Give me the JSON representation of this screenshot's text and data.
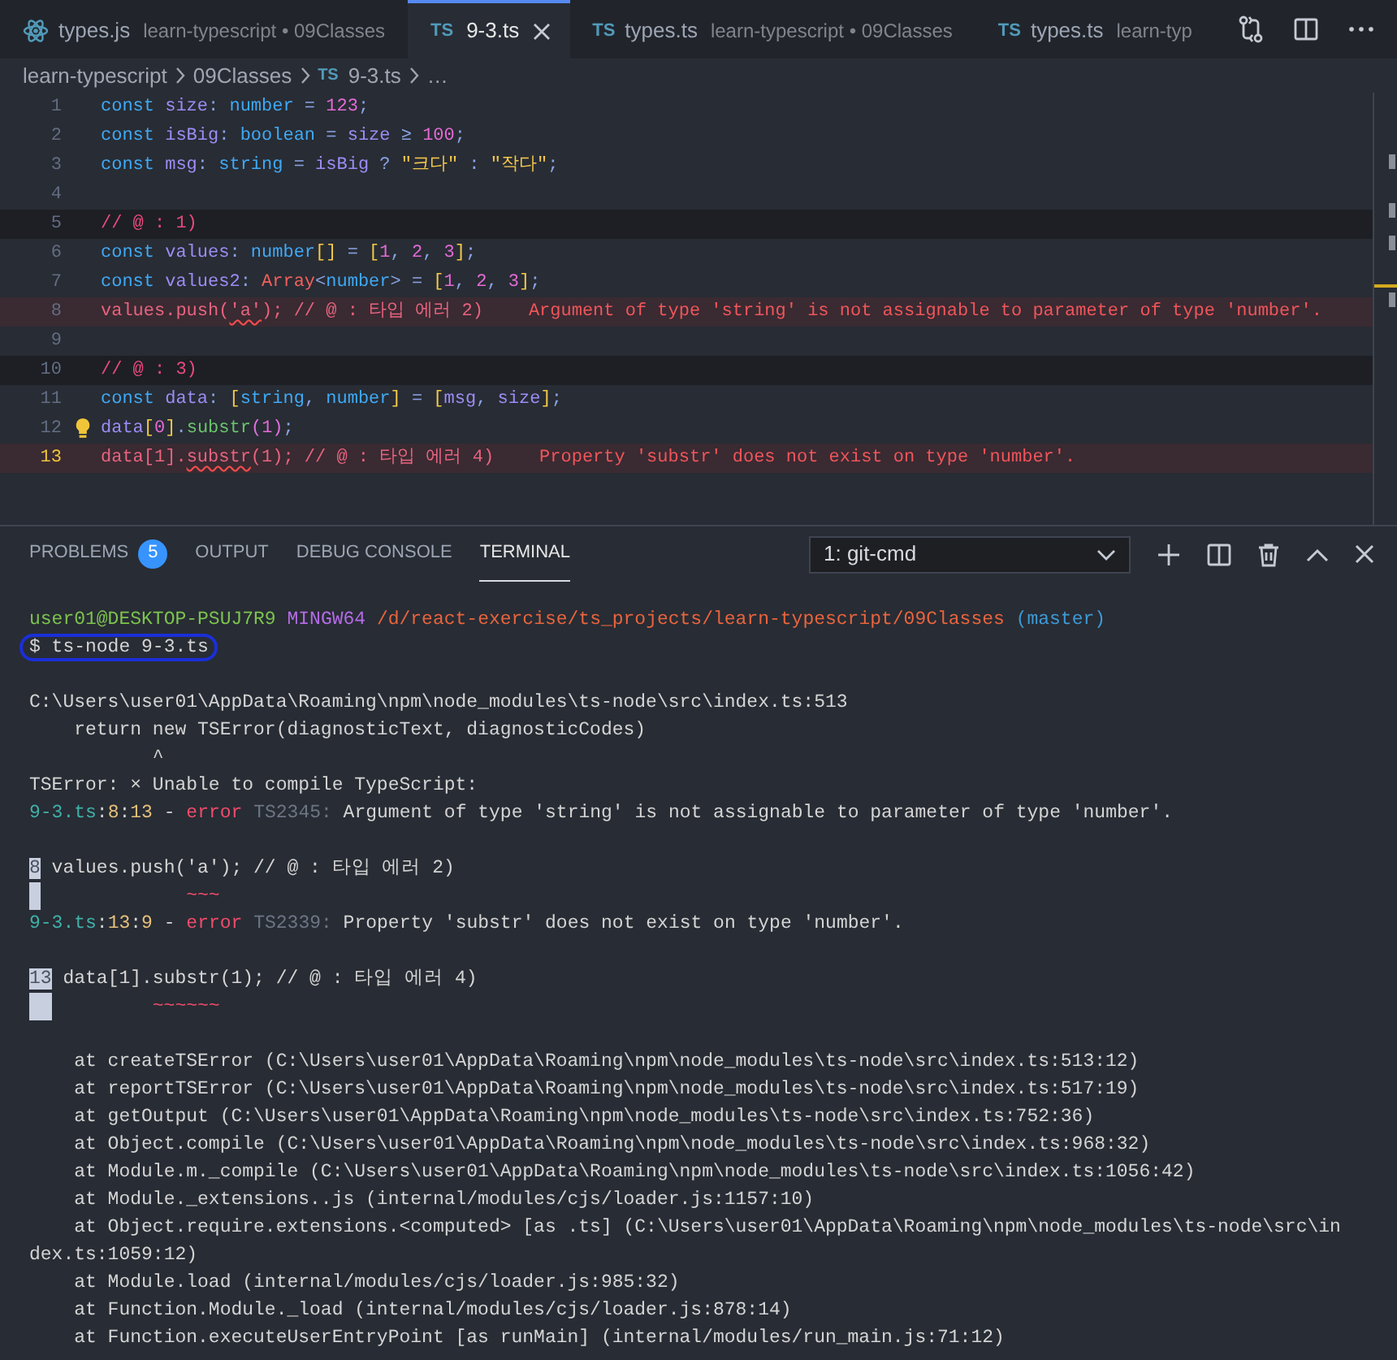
{
  "editor_tabs": [
    {
      "kind": "js",
      "name": "types.js",
      "description": "learn-typescript • 09Classes",
      "selected": false
    },
    {
      "kind": "ts",
      "badge": "TS",
      "name": "9-3.ts",
      "selected": true
    },
    {
      "kind": "ts",
      "badge": "TS",
      "name": "types.ts",
      "description": "learn-typescript • 09Classes",
      "selected": false
    },
    {
      "kind": "ts",
      "badge": "TS",
      "name": "types.ts",
      "description": "learn-typ",
      "selected": false
    }
  ],
  "breadcrumb": [
    {
      "text": "learn-typescript"
    },
    {
      "text": "09Classes"
    },
    {
      "badge": "TS",
      "text": "9-3.ts"
    },
    {
      "text": "…"
    }
  ],
  "code_lines": [
    {
      "number": "1",
      "error": false,
      "banded": false,
      "current": false,
      "lightbulb": false,
      "tokens": [
        {
          "kind": "kw",
          "text": "const "
        },
        {
          "kind": "var",
          "text": "size"
        },
        {
          "kind": "op",
          "text": ": "
        },
        {
          "kind": "type",
          "text": "number"
        },
        {
          "kind": "op",
          "text": " = "
        },
        {
          "kind": "num",
          "text": "123"
        },
        {
          "kind": "op",
          "text": ";"
        }
      ]
    },
    {
      "number": "2",
      "error": false,
      "banded": false,
      "current": false,
      "lightbulb": false,
      "tokens": [
        {
          "kind": "kw",
          "text": "const "
        },
        {
          "kind": "var",
          "text": "isBig"
        },
        {
          "kind": "op",
          "text": ": "
        },
        {
          "kind": "type",
          "text": "boolean"
        },
        {
          "kind": "op",
          "text": " = "
        },
        {
          "kind": "var",
          "text": "size"
        },
        {
          "kind": "op",
          "text": " ≥ "
        },
        {
          "kind": "num",
          "text": "100"
        },
        {
          "kind": "op",
          "text": ";"
        }
      ]
    },
    {
      "number": "3",
      "error": false,
      "banded": false,
      "current": false,
      "lightbulb": false,
      "tokens": [
        {
          "kind": "kw",
          "text": "const "
        },
        {
          "kind": "var",
          "text": "msg"
        },
        {
          "kind": "op",
          "text": ": "
        },
        {
          "kind": "type",
          "text": "string"
        },
        {
          "kind": "op",
          "text": " = "
        },
        {
          "kind": "var",
          "text": "isBig"
        },
        {
          "kind": "op",
          "text": " ? "
        },
        {
          "kind": "str",
          "text": "\"크다\""
        },
        {
          "kind": "op",
          "text": " : "
        },
        {
          "kind": "str",
          "text": "\"작다\""
        },
        {
          "kind": "op",
          "text": ";"
        }
      ]
    },
    {
      "number": "4",
      "error": false,
      "banded": false,
      "current": false,
      "lightbulb": false
    },
    {
      "number": "5",
      "error": false,
      "banded": true,
      "current": false,
      "lightbulb": false,
      "tokens": [
        {
          "kind": "cm",
          "text": "// @ : 1)"
        }
      ]
    },
    {
      "number": "6",
      "error": false,
      "banded": false,
      "current": false,
      "lightbulb": false,
      "tokens": [
        {
          "kind": "kw",
          "text": "const "
        },
        {
          "kind": "var",
          "text": "values"
        },
        {
          "kind": "op",
          "text": ": "
        },
        {
          "kind": "type",
          "text": "number"
        },
        {
          "kind": "b1",
          "text": "[]"
        },
        {
          "kind": "op",
          "text": " = "
        },
        {
          "kind": "b1",
          "text": "["
        },
        {
          "kind": "num",
          "text": "1"
        },
        {
          "kind": "op",
          "text": ", "
        },
        {
          "kind": "num",
          "text": "2"
        },
        {
          "kind": "op",
          "text": ", "
        },
        {
          "kind": "num",
          "text": "3"
        },
        {
          "kind": "b1",
          "text": "]"
        },
        {
          "kind": "op",
          "text": ";"
        }
      ]
    },
    {
      "number": "7",
      "error": false,
      "banded": false,
      "current": false,
      "lightbulb": false,
      "tokens": [
        {
          "kind": "kw",
          "text": "const "
        },
        {
          "kind": "var",
          "text": "values2"
        },
        {
          "kind": "op",
          "text": ": "
        },
        {
          "kind": "cls",
          "text": "Array"
        },
        {
          "kind": "op",
          "text": "<"
        },
        {
          "kind": "type",
          "text": "number"
        },
        {
          "kind": "op",
          "text": "> = "
        },
        {
          "kind": "b1",
          "text": "["
        },
        {
          "kind": "num",
          "text": "1"
        },
        {
          "kind": "op",
          "text": ", "
        },
        {
          "kind": "num",
          "text": "2"
        },
        {
          "kind": "op",
          "text": ", "
        },
        {
          "kind": "num",
          "text": "3"
        },
        {
          "kind": "b1",
          "text": "]"
        },
        {
          "kind": "op",
          "text": ";"
        }
      ]
    },
    {
      "number": "8",
      "error": true,
      "banded": false,
      "current": false,
      "lightbulb": false,
      "tokens": [
        {
          "kind": "err",
          "text": "values.push("
        },
        {
          "kind": "err",
          "text": "'a'",
          "squiggle": true
        },
        {
          "kind": "err",
          "text": "); // @ : 타입 에러 2)"
        }
      ],
      "diagnostic": "Argument of type 'string' is not assignable to parameter of type 'number'."
    },
    {
      "number": "9",
      "error": false,
      "banded": false,
      "current": false,
      "lightbulb": false
    },
    {
      "number": "10",
      "error": false,
      "banded": true,
      "current": false,
      "lightbulb": false,
      "tokens": [
        {
          "kind": "cm",
          "text": "// @ : 3)"
        }
      ]
    },
    {
      "number": "11",
      "error": false,
      "banded": false,
      "current": false,
      "lightbulb": false,
      "tokens": [
        {
          "kind": "kw",
          "text": "const "
        },
        {
          "kind": "var",
          "text": "data"
        },
        {
          "kind": "op",
          "text": ": "
        },
        {
          "kind": "b1",
          "text": "["
        },
        {
          "kind": "type",
          "text": "string"
        },
        {
          "kind": "op",
          "text": ", "
        },
        {
          "kind": "type",
          "text": "number"
        },
        {
          "kind": "b1",
          "text": "]"
        },
        {
          "kind": "op",
          "text": " = "
        },
        {
          "kind": "b1",
          "text": "["
        },
        {
          "kind": "var",
          "text": "msg"
        },
        {
          "kind": "op",
          "text": ", "
        },
        {
          "kind": "var",
          "text": "size"
        },
        {
          "kind": "b1",
          "text": "]"
        },
        {
          "kind": "op",
          "text": ";"
        }
      ]
    },
    {
      "number": "12",
      "error": false,
      "banded": false,
      "current": false,
      "lightbulb": true,
      "tokens": [
        {
          "kind": "var",
          "text": "data"
        },
        {
          "kind": "b1",
          "text": "["
        },
        {
          "kind": "num",
          "text": "0"
        },
        {
          "kind": "b1",
          "text": "]"
        },
        {
          "kind": "op",
          "text": "."
        },
        {
          "kind": "fn",
          "text": "substr"
        },
        {
          "kind": "b2",
          "text": "("
        },
        {
          "kind": "num",
          "text": "1"
        },
        {
          "kind": "b2",
          "text": ")"
        },
        {
          "kind": "op",
          "text": ";"
        }
      ]
    },
    {
      "number": "13",
      "error": true,
      "banded": false,
      "current": true,
      "lightbulb": false,
      "tokens": [
        {
          "kind": "err",
          "text": "data[1]."
        },
        {
          "kind": "err",
          "text": "substr",
          "squiggle": true
        },
        {
          "kind": "err",
          "text": "(1); // @ : 타입 에러 4)"
        }
      ],
      "diagnostic": "Property 'substr' does not exist on type 'number'."
    }
  ],
  "panel_tabs": [
    {
      "label": "PROBLEMS",
      "badge": "5",
      "selected": false
    },
    {
      "label": "OUTPUT",
      "selected": false
    },
    {
      "label": "DEBUG CONSOLE",
      "selected": false
    },
    {
      "label": "TERMINAL",
      "selected": true
    }
  ],
  "terminal_select": {
    "value": "1: git-cmd"
  },
  "terminal_lines": [
    {
      "kind": "text",
      "segments": [
        {
          "kind": "user",
          "text": "user01@DESKTOP-PSUJ7R9 "
        },
        {
          "kind": "host",
          "text": "MINGW64 "
        },
        {
          "kind": "path",
          "text": "/d/react-exercise/ts_projects/learn-typescript/09Classes "
        },
        {
          "kind": "branch",
          "text": "(master)"
        }
      ]
    },
    {
      "kind": "text",
      "segments": [
        {
          "kind": "cmd",
          "text": "$ ts-node 9-3.ts"
        }
      ]
    },
    {
      "kind": "blank"
    },
    {
      "kind": "text",
      "segments": [
        {
          "kind": "plain",
          "text": "C:\\Users\\user01\\AppData\\Roaming\\npm\\node_modules\\ts-node\\src\\index.ts:513"
        }
      ]
    },
    {
      "kind": "text",
      "segments": [
        {
          "kind": "plain",
          "text": "    return new TSError(diagnosticText, diagnosticCodes)"
        }
      ]
    },
    {
      "kind": "text",
      "segments": [
        {
          "kind": "plain",
          "text": "           ^"
        }
      ]
    },
    {
      "kind": "text",
      "segments": [
        {
          "kind": "plain",
          "text": "TSError: × Unable to compile TypeScript:"
        }
      ]
    },
    {
      "kind": "text",
      "segments": [
        {
          "kind": "file",
          "text": "9-3.ts"
        },
        {
          "kind": "plain",
          "text": ":"
        },
        {
          "kind": "pos",
          "text": "8"
        },
        {
          "kind": "plain",
          "text": ":"
        },
        {
          "kind": "pos",
          "text": "13"
        },
        {
          "kind": "plain",
          "text": " - "
        },
        {
          "kind": "error",
          "text": "error "
        },
        {
          "kind": "code",
          "text": "TS2345:"
        },
        {
          "kind": "plain",
          "text": " Argument of type 'string' is not assignable to parameter of type 'number'."
        }
      ]
    },
    {
      "kind": "blank"
    },
    {
      "kind": "text",
      "segments": [
        {
          "kind": "gutter",
          "text": "8"
        },
        {
          "kind": "plain",
          "text": " values.push('a'); // @ : 타입 에러 2)"
        }
      ]
    },
    {
      "kind": "text",
      "segments": [
        {
          "kind": "gutter"
        },
        {
          "kind": "squiggle",
          "text": "             ~~~"
        }
      ]
    },
    {
      "kind": "text",
      "segments": [
        {
          "kind": "file",
          "text": "9-3.ts"
        },
        {
          "kind": "plain",
          "text": ":"
        },
        {
          "kind": "pos",
          "text": "13"
        },
        {
          "kind": "plain",
          "text": ":"
        },
        {
          "kind": "pos",
          "text": "9"
        },
        {
          "kind": "plain",
          "text": " - "
        },
        {
          "kind": "error",
          "text": "error "
        },
        {
          "kind": "code",
          "text": "TS2339:"
        },
        {
          "kind": "plain",
          "text": " Property 'substr' does not exist on type 'number'."
        }
      ]
    },
    {
      "kind": "blank"
    },
    {
      "kind": "text",
      "segments": [
        {
          "kind": "gutter",
          "text": "13"
        },
        {
          "kind": "plain",
          "text": " data[1].substr(1); // @ : 타입 에러 4)"
        }
      ]
    },
    {
      "kind": "text",
      "segments": [
        {
          "kind": "gutter"
        },
        {
          "kind": "gutter"
        },
        {
          "kind": "squiggle",
          "text": "         ~~~~~~"
        }
      ]
    },
    {
      "kind": "blank"
    },
    {
      "kind": "text",
      "segments": [
        {
          "kind": "plain",
          "text": "    at createTSError (C:\\Users\\user01\\AppData\\Roaming\\npm\\node_modules\\ts-node\\src\\index.ts:513:12)"
        }
      ]
    },
    {
      "kind": "text",
      "segments": [
        {
          "kind": "plain",
          "text": "    at reportTSError (C:\\Users\\user01\\AppData\\Roaming\\npm\\node_modules\\ts-node\\src\\index.ts:517:19)"
        }
      ]
    },
    {
      "kind": "text",
      "segments": [
        {
          "kind": "plain",
          "text": "    at getOutput (C:\\Users\\user01\\AppData\\Roaming\\npm\\node_modules\\ts-node\\src\\index.ts:752:36)"
        }
      ]
    },
    {
      "kind": "text",
      "segments": [
        {
          "kind": "plain",
          "text": "    at Object.compile (C:\\Users\\user01\\AppData\\Roaming\\npm\\node_modules\\ts-node\\src\\index.ts:968:32)"
        }
      ]
    },
    {
      "kind": "text",
      "segments": [
        {
          "kind": "plain",
          "text": "    at Module.m._compile (C:\\Users\\user01\\AppData\\Roaming\\npm\\node_modules\\ts-node\\src\\index.ts:1056:42)"
        }
      ]
    },
    {
      "kind": "text",
      "segments": [
        {
          "kind": "plain",
          "text": "    at Module._extensions..js (internal/modules/cjs/loader.js:1157:10)"
        }
      ]
    },
    {
      "kind": "text",
      "segments": [
        {
          "kind": "plain",
          "text": "    at Object.require.extensions.<computed> [as .ts] (C:\\Users\\user01\\AppData\\Roaming\\npm\\node_modules\\ts-node\\src\\in"
        }
      ]
    },
    {
      "kind": "text",
      "segments": [
        {
          "kind": "plain",
          "text": "dex.ts:1059:12)"
        }
      ]
    },
    {
      "kind": "text",
      "segments": [
        {
          "kind": "plain",
          "text": "    at Module.load (internal/modules/cjs/loader.js:985:32)"
        }
      ]
    },
    {
      "kind": "text",
      "segments": [
        {
          "kind": "plain",
          "text": "    at Function.Module._load (internal/modules/cjs/loader.js:878:14)"
        }
      ]
    },
    {
      "kind": "text",
      "segments": [
        {
          "kind": "plain",
          "text": "    at Function.executeUserEntryPoint [as runMain] (internal/modules/run_main.js:71:12)"
        }
      ]
    }
  ]
}
